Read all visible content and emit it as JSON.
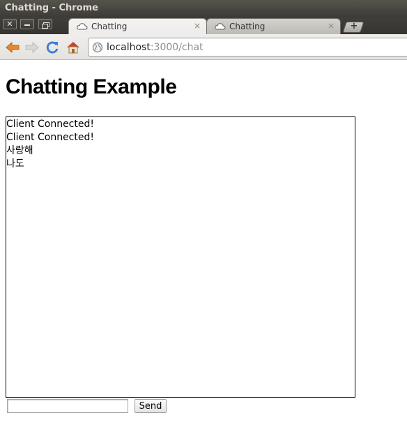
{
  "window": {
    "title": "Chatting - Chrome",
    "controls": {
      "close_glyph": "✕"
    }
  },
  "tabs": [
    {
      "label": "Chatting",
      "icon": "page-icon",
      "active": true
    },
    {
      "label": "Chatting",
      "icon": "page-icon",
      "active": false
    }
  ],
  "tab_close_glyph": "×",
  "new_tab_glyph": "+",
  "toolbar": {
    "url_host": "localhost",
    "url_rest": ":3000/chat",
    "icons": [
      "back-arrow-icon",
      "forward-arrow-icon",
      "reload-icon",
      "home-icon",
      "globe-icon"
    ]
  },
  "page": {
    "title": "Chatting Example",
    "messages": [
      "Client Connected!",
      "Client Connected!",
      "사랑해",
      "나도"
    ],
    "input": {
      "value": "",
      "placeholder": ""
    },
    "send_label": "Send"
  },
  "colors": {
    "titlebar": "#3d3b37",
    "back_arrow": "#e38a2c",
    "reload": "#3c7fd6",
    "home_roof": "#c9432b"
  }
}
